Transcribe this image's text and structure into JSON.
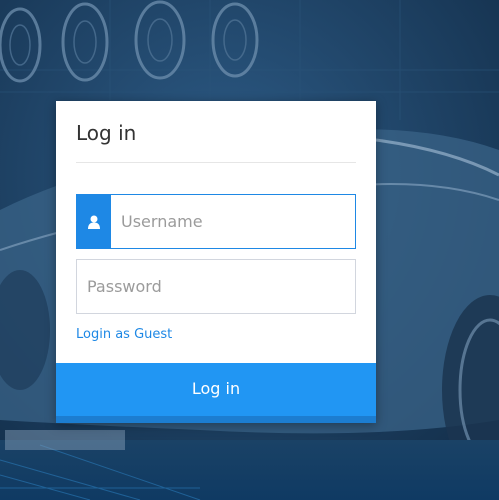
{
  "login": {
    "title": "Log in",
    "username_placeholder": "Username",
    "username_value": "",
    "password_placeholder": "Password",
    "password_value": "",
    "guest_link": "Login as Guest",
    "submit_label": "Log in"
  },
  "icons": {
    "username_addon": "user-icon"
  },
  "colors": {
    "accent": "#2196f3",
    "accent_dark": "#1c7dd0",
    "input_border_focus": "#1e88e5",
    "background": "#1b3f63"
  }
}
